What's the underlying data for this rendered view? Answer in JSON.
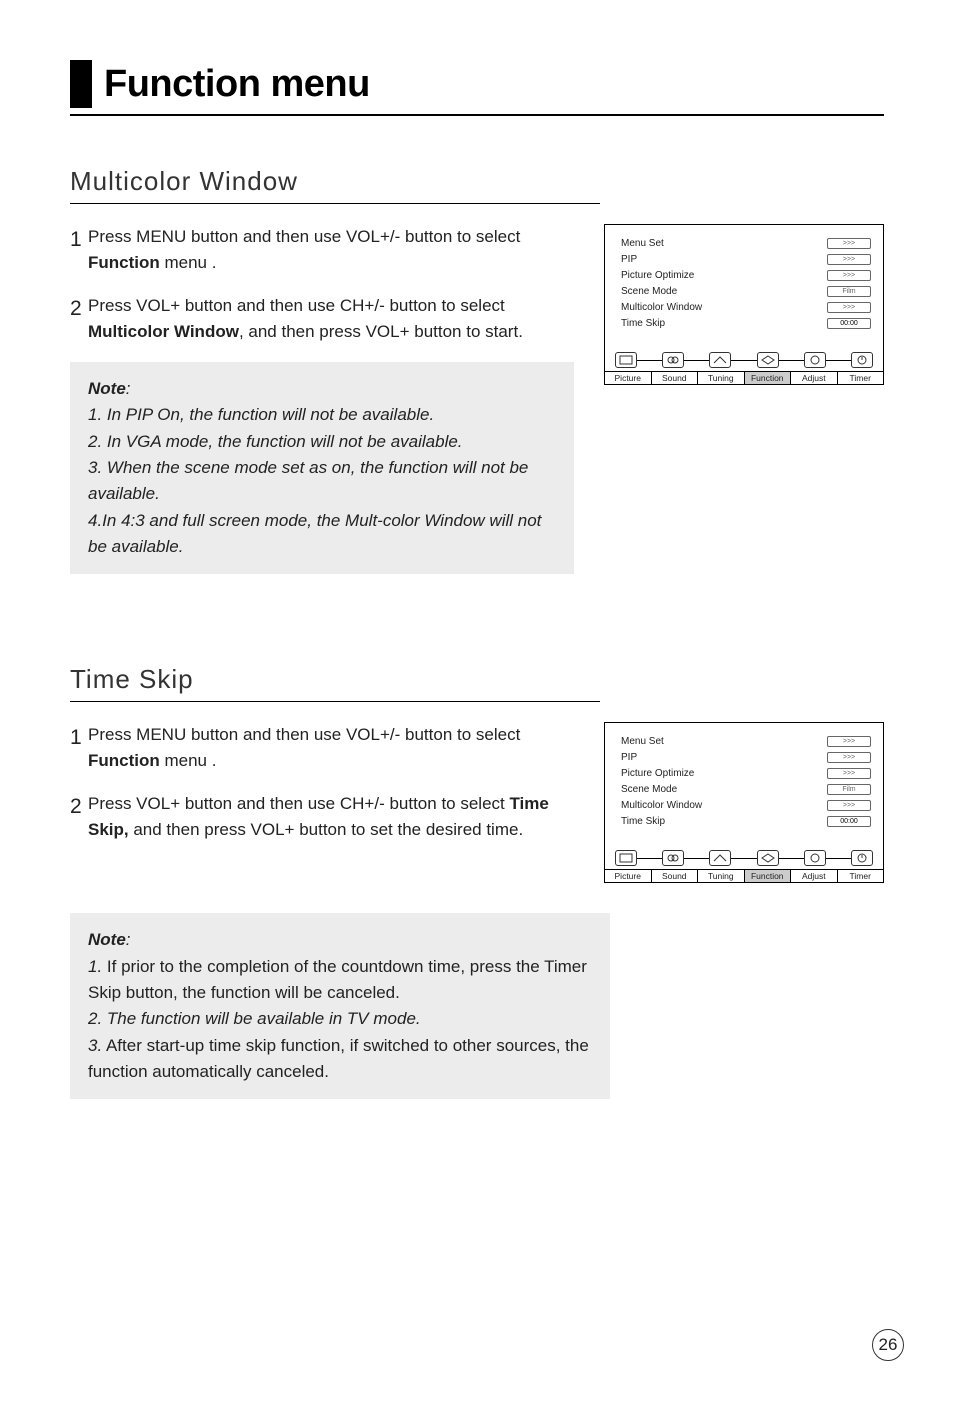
{
  "title": "Function menu",
  "page_number": "26",
  "section1": {
    "heading": "Multicolor Window",
    "step1_num": "1",
    "step1_a": "Press MENU button and then use VOL+/- button to select ",
    "step1_b": "Function",
    "step1_c": " menu .",
    "step2_num": "2",
    "step2_a": "Press VOL+ button and then use CH+/- button to select ",
    "step2_b": "Multicolor Window",
    "step2_c": ", and then press VOL+ button to start.",
    "note_label": "Note",
    "note_colon": ":",
    "note_lines": [
      "1. In PIP On, the function will not be available.",
      "2. In VGA mode, the function will not be available.",
      "3. When the scene mode set as on, the function will not be available.",
      "4.In 4:3 and full screen mode, the Mult-color Window will not be available."
    ]
  },
  "section2": {
    "heading": "Time Skip",
    "step1_num": "1",
    "step1_a": "Press MENU button and then use VOL+/- button to select ",
    "step1_b": "Function",
    "step1_c": " menu .",
    "step2_num": "2",
    "step2_a": "Press VOL+ button and then use CH+/- button to select ",
    "step2_b": "Time Skip,",
    "step2_c": " and then press VOL+ button to set the desired time.",
    "note_label": "Note",
    "note_colon": ":",
    "note1_n": "1.",
    "note1_t": " If prior to the completion of the countdown time, press the Timer Skip button, the function will be canceled.",
    "note2": "2. The function will be available in TV mode.",
    "note3_n": "3.",
    "note3_t": " After start-up time skip function, if switched to other sources, the function automatically canceled."
  },
  "osd": {
    "rows": [
      {
        "label": "Menu Set",
        "value": ">>>"
      },
      {
        "label": "PIP",
        "value": ">>>"
      },
      {
        "label": "Picture Optimize",
        "value": ">>>"
      },
      {
        "label": "Scene Mode",
        "value": "Film"
      },
      {
        "label": "Multicolor Window",
        "value": ">>>"
      },
      {
        "label": "Time Skip",
        "value": "00:00"
      }
    ],
    "tabs": [
      "Picture",
      "Sound",
      "Tuning",
      "Function",
      "Adjust",
      "Timer"
    ],
    "active_tab_index": 3
  }
}
